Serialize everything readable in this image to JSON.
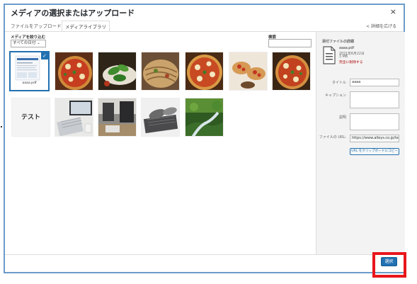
{
  "dialog": {
    "title": "メディアの選択またはアップロード",
    "close": "×"
  },
  "tabs": [
    {
      "label": "ファイルをアップロード"
    },
    {
      "label": "メディアライブラリ"
    }
  ],
  "expand_link": "< 詳細を広げる",
  "filter": {
    "label": "メディアを絞り込む",
    "selected": "すべての日付 ⌄"
  },
  "search": {
    "label": "検索",
    "value": ""
  },
  "grid": {
    "pdf_caption": "aaaa.pdf",
    "text_tile": "テスト",
    "checkmark": "✓"
  },
  "details": {
    "heading": "添付ファイルの詳細",
    "file_name": "aaaa.pdf",
    "date": "2021年6月22日",
    "size": "3 MB",
    "delete_link": "完全に削除する",
    "title_label": "タイトル",
    "title_value": "aaaa",
    "caption_label": "キャプション",
    "description_label": "説明",
    "url_label": "ファイルの URL:",
    "url_value": "https://www.alleys.co.jp/te",
    "copy_button": "URL をクリップボードにコピー"
  },
  "footer": {
    "select_button": "選択"
  },
  "colors": {
    "accent": "#2271b1",
    "highlight": "#e8161c",
    "frame": "#6b9bc9"
  }
}
